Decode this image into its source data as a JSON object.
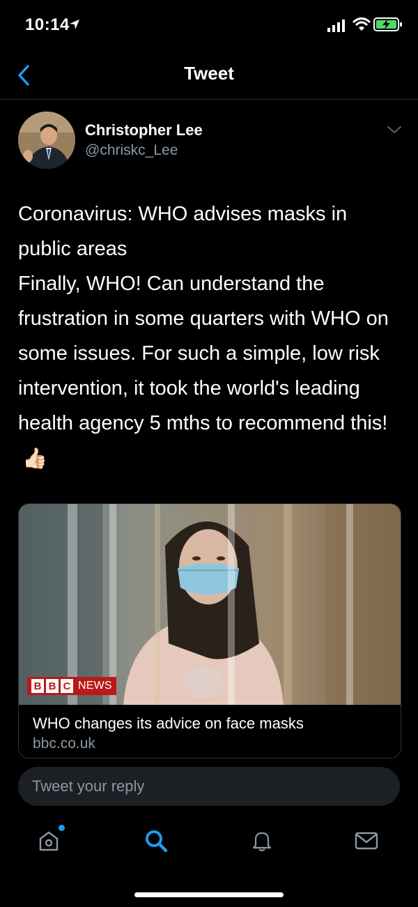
{
  "status": {
    "time": "10:14",
    "battery_state": "charging"
  },
  "nav": {
    "title": "Tweet",
    "back_icon": "chevron-left-icon"
  },
  "tweet": {
    "author_name": "Christopher Lee",
    "author_handle": "@chriskc_Lee",
    "headline": "Coronavirus: WHO advises masks in public areas",
    "body": "Finally, WHO! Can understand the frustration in some quarters with WHO on some issues. For such a simple, low risk intervention, it took the world's leading health agency 5 mths to recommend this!",
    "emoji": "👍🏻"
  },
  "card": {
    "source_logo": "BBC",
    "source_logo_suffix": "NEWS",
    "title": "WHO changes its advice on face masks",
    "domain": "bbc.co.uk"
  },
  "reply": {
    "placeholder": "Tweet your reply"
  },
  "tabs": [
    {
      "name": "home",
      "icon": "home-icon"
    },
    {
      "name": "search",
      "icon": "search-icon",
      "active": true
    },
    {
      "name": "notifications",
      "icon": "bell-icon"
    },
    {
      "name": "messages",
      "icon": "mail-icon"
    }
  ],
  "colors": {
    "accent": "#1d9bf0",
    "background": "#000000",
    "secondary_text": "#8b98a5",
    "bbc_red": "#bb1919"
  }
}
